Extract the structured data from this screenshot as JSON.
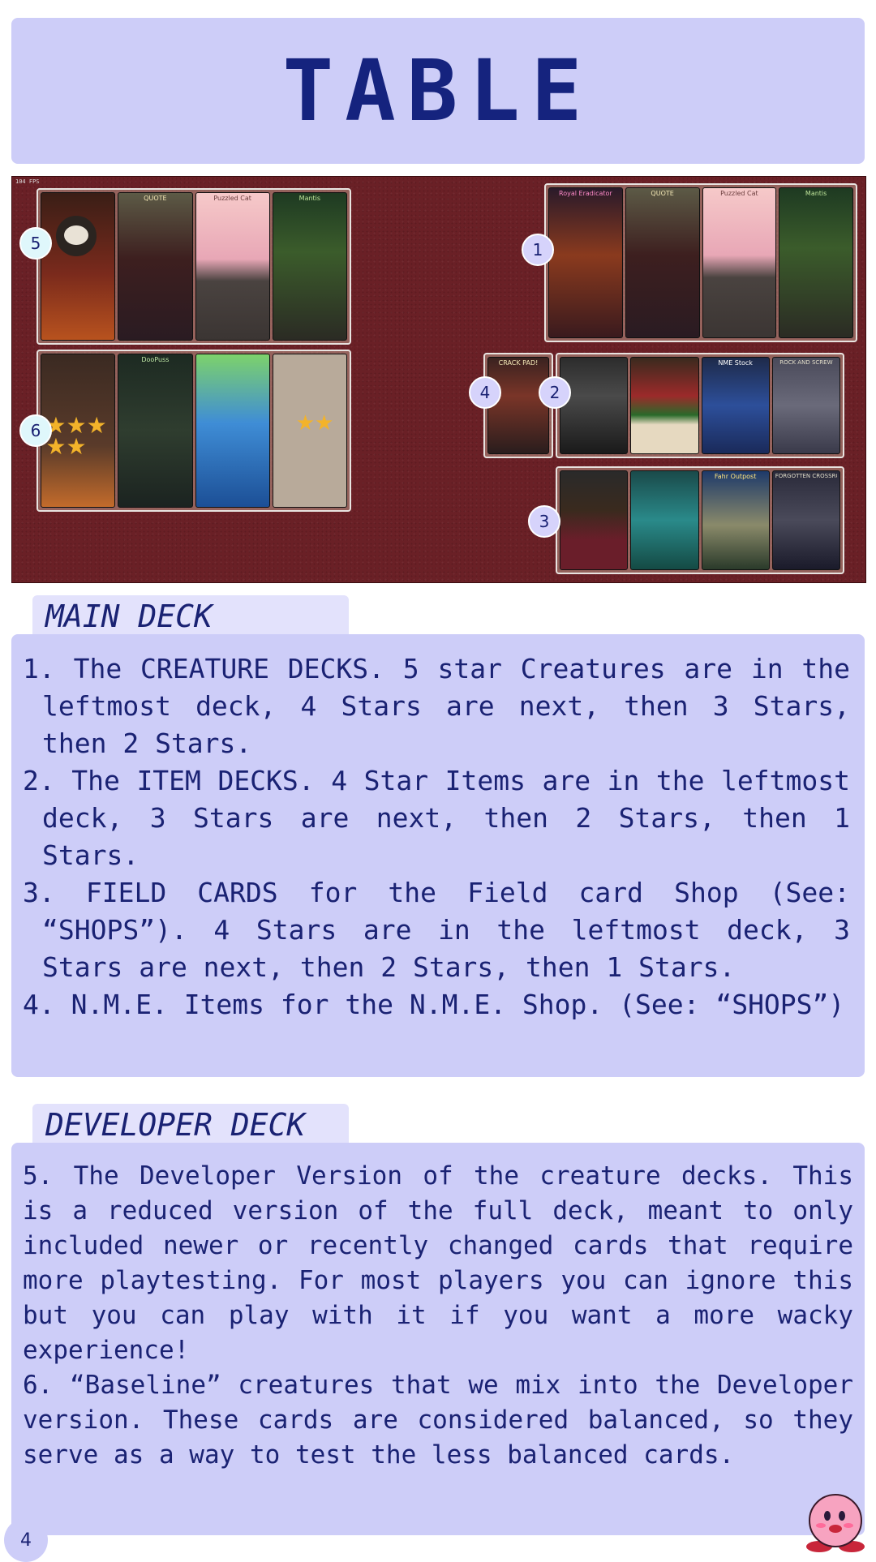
{
  "title": "TABLE",
  "table_image": {
    "fps_label": "104 FPS",
    "markers": [
      "1",
      "2",
      "3",
      "4",
      "5",
      "6"
    ],
    "cards": {
      "group1": [
        "Royal Eradicator",
        "QUOTE",
        "Puzzled Cat",
        "Mantis"
      ],
      "group2_single": "CRACK PAD!",
      "group2": [
        "",
        "",
        "NME Stock",
        "ROCK AND SCREW"
      ],
      "group3": [
        "",
        "",
        "Fahr Outpost",
        "FORGOTTEN CROSSROADS"
      ],
      "group5": [
        "",
        "QUOTE",
        "Puzzled Cat",
        "Mantis"
      ],
      "group6": [
        "",
        "DooPuss",
        "",
        ""
      ]
    }
  },
  "main_deck": {
    "heading": "MAIN DECK",
    "items": [
      {
        "num": "1.",
        "text": "The CREATURE DECKS. 5 star Creatures are in the leftmost deck, 4 Stars are next, then 3 Stars, then 2 Stars."
      },
      {
        "num": "2.",
        "text": "The ITEM DECKS. 4 Star Items are in the leftmost deck, 3 Stars are next, then 2 Stars, then 1 Stars."
      },
      {
        "num": "3.",
        "text": "FIELD CARDS for the Field card Shop (See: “SHOPS”). 4 Stars are in the leftmost deck, 3 Stars are next, then 2 Stars, then 1 Stars."
      },
      {
        "num": "4.",
        "text": "N.M.E. Items for the N.M.E. Shop. (See: “SHOPS”)"
      }
    ]
  },
  "developer_deck": {
    "heading": "DEVELOPER DECK",
    "para5": "5. The Developer Version of the creature decks. This is a reduced version of the full deck, meant to only included newer or recently changed cards that require more playtesting. For most players you can ignore this but you can play with it if you want a more wacky experience!",
    "para6": "6. “Baseline” creatures that we mix into the Developer version. These cards are considered balanced, so they serve as a way to test the less balanced cards."
  },
  "page_number": "4",
  "colors": {
    "box": "#cdcdf8",
    "text": "#1a2273",
    "table": "#6a2026"
  }
}
